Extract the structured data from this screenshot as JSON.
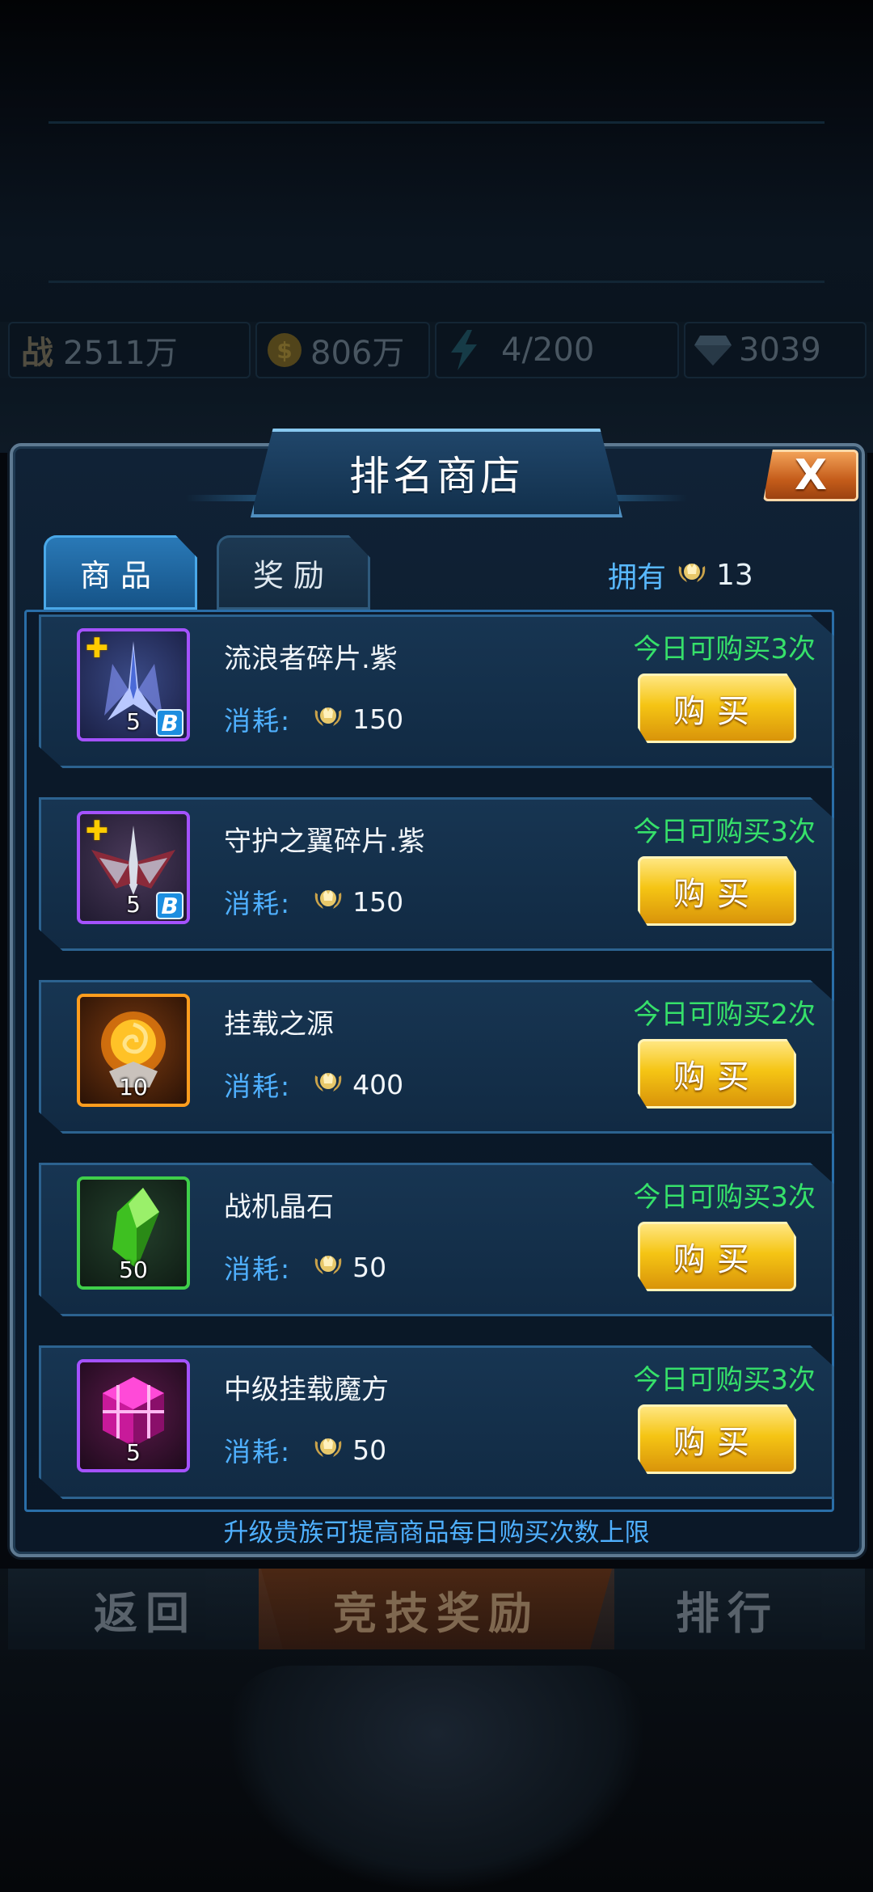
{
  "hud": {
    "power_icon": "战",
    "power_value": "2511万",
    "gold_value": "806万",
    "energy_value": "4/200",
    "diamond_value": "3039"
  },
  "bottom_nav": {
    "back": "返回",
    "arena_rewards": "竞技奖励",
    "ranking": "排行"
  },
  "shop": {
    "title": "排名商店",
    "close": "X",
    "tabs": [
      "商品",
      "奖励"
    ],
    "owned_label": "拥有",
    "owned_value": "13",
    "currency_icon": "laurel-crown-icon",
    "footer_note": "升级贵族可提高商品每日购买次数上限",
    "cost_label": "消耗:",
    "buy_label": "购买",
    "items": [
      {
        "name": "流浪者碎片.紫",
        "cost": "150",
        "limit": "今日可购买3次",
        "qty": "5",
        "icon": "fighter-jet-icon",
        "border": "#a452ff",
        "grade": "B"
      },
      {
        "name": "守护之翼碎片.紫",
        "cost": "150",
        "limit": "今日可购买3次",
        "qty": "5",
        "icon": "wing-fighter-icon",
        "border": "#a452ff",
        "grade": "B"
      },
      {
        "name": "挂载之源",
        "cost": "400",
        "limit": "今日可购买2次",
        "qty": "10",
        "icon": "fire-orb-icon",
        "border": "#ff9d1e"
      },
      {
        "name": "战机晶石",
        "cost": "50",
        "limit": "今日可购买3次",
        "qty": "50",
        "icon": "green-crystal-icon",
        "border": "#3fcf4a"
      },
      {
        "name": "中级挂载魔方",
        "cost": "50",
        "limit": "今日可购买3次",
        "qty": "5",
        "icon": "magic-cube-icon",
        "border": "#a452ff"
      }
    ]
  }
}
